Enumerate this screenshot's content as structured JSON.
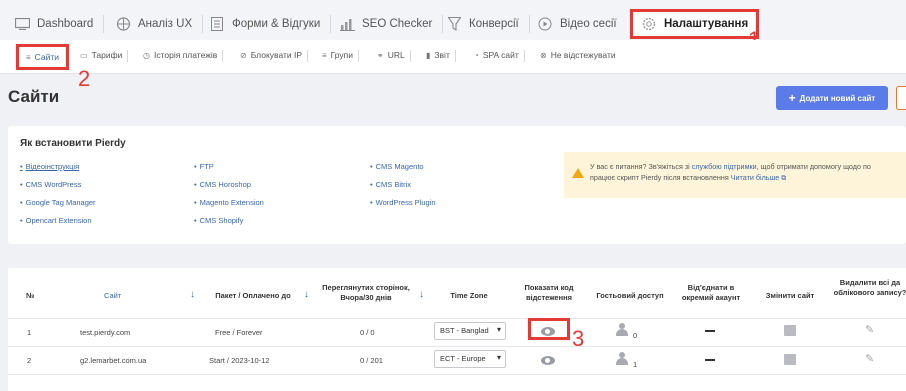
{
  "tabs": [
    {
      "label": "Dashboard",
      "icon": "monitor-icon"
    },
    {
      "label": "Аналіз UX",
      "icon": "analysis-icon"
    },
    {
      "label": "Форми & Відгуки",
      "icon": "form-icon"
    },
    {
      "label": "SEO Checker",
      "icon": "bar-chart-icon"
    },
    {
      "label": "Конверсії",
      "icon": "funnel-icon"
    },
    {
      "label": "Відео сесії",
      "icon": "play-icon"
    },
    {
      "label": "Налаштування",
      "icon": "gear-icon"
    }
  ],
  "subnav": [
    {
      "label": "Сайти",
      "icon": "list-icon"
    },
    {
      "label": "Тарифи",
      "icon": "card-icon"
    },
    {
      "label": "Історія платежів",
      "icon": "history-icon"
    },
    {
      "label": "Блокувати IP",
      "icon": "block-icon"
    },
    {
      "label": "Групи",
      "icon": "group-icon"
    },
    {
      "label": "URL",
      "icon": "link-icon"
    },
    {
      "label": "Звіт",
      "icon": "report-icon"
    },
    {
      "label": "SPA сайт",
      "icon": "spa-icon"
    },
    {
      "label": "Не відстежувати",
      "icon": "no-track-icon"
    }
  ],
  "annotations": {
    "a1": "1",
    "a2": "2",
    "a3": "3"
  },
  "page": {
    "title": "Сайти",
    "add_button": "Додати новий сайт"
  },
  "install": {
    "title": "Як встановити Pierdy",
    "col1": [
      "Відеоінструкція",
      "CMS WordPress",
      "Google Tag Manager",
      "Opencart Extension"
    ],
    "col2": [
      "FTP",
      "CMS Horoshop",
      "Magento Extension",
      "CMS Shopify"
    ],
    "col3": [
      "CMS Magento",
      "CMS Bitrix",
      "WordPress Plugin"
    ],
    "notice_line1_a": "У вас є питання? Зв'яжіться зі ",
    "notice_link1": "службою підтримки",
    "notice_line1_b": ", щоб отримати допомогу щодо по",
    "notice_line2_a": "працює скрипт Pierdy після встановлення ",
    "notice_link2": "Читати більше ⧉"
  },
  "table": {
    "headers": {
      "num": "№",
      "site": "Сайт",
      "plan": "Пакет / Оплачено до",
      "pages": "Переглянутих сторінок, Вчора/30 днів",
      "tz": "Time Zone",
      "code": "Показати код відстеження",
      "guest": "Гостьовий доступ",
      "detach": "Від'єднати в окремий акаунт",
      "change": "Змінити сайт",
      "delete": "Видалити всі да облікового запису?"
    },
    "rows": [
      {
        "num": "1",
        "site": "test.pierdy.com",
        "plan": "Free / Forever",
        "pages": "0 / 0",
        "tz": "BST - Banglad",
        "guests": "0"
      },
      {
        "num": "2",
        "site": "g2.lemarbet.com.ua",
        "plan": "Start / 2023-10-12",
        "pages": "0 / 201",
        "tz": "ECT - Europe",
        "guests": "1"
      }
    ]
  }
}
